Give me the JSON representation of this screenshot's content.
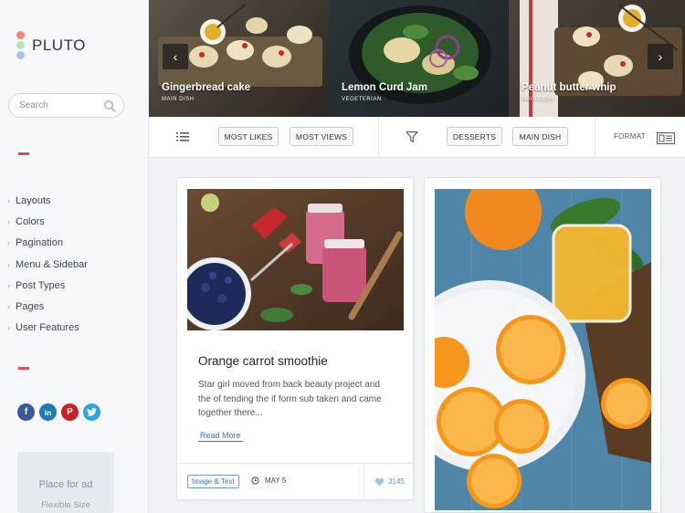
{
  "brand": {
    "name": "PLUTO",
    "dot_colors": [
      "#f0857f",
      "#b9e3b4",
      "#a9c6ea"
    ]
  },
  "search": {
    "placeholder": "Search"
  },
  "menu": [
    {
      "label": "Layouts"
    },
    {
      "label": "Colors"
    },
    {
      "label": "Pagination"
    },
    {
      "label": "Menu & Sidebar"
    },
    {
      "label": "Post Types"
    },
    {
      "label": "Pages"
    },
    {
      "label": "User Features"
    }
  ],
  "socials": [
    {
      "icon": "facebook-icon",
      "glyph": "f",
      "color": "#3b5998"
    },
    {
      "icon": "linkedin-icon",
      "glyph": "in",
      "color": "#1f7bb6"
    },
    {
      "icon": "pinterest-icon",
      "glyph": "P",
      "color": "#cb2027"
    },
    {
      "icon": "twitter-icon",
      "glyph": "t",
      "color": "#2aa4e2"
    }
  ],
  "ad": {
    "title": "Place for ad",
    "subtitle": "Flexible Size"
  },
  "slider": {
    "slides": [
      {
        "title": "Gingerbread cake",
        "category": "MAIN DISH"
      },
      {
        "title": "Lemon Curd Jam",
        "category": "VEGETERIAN"
      },
      {
        "title": "Peanut butter whip",
        "category": "MAIN DISH"
      }
    ]
  },
  "filters": {
    "sort": [
      "MOST LIKES",
      "MOST VIEWS"
    ],
    "categories": [
      "DESSERTS",
      "MAIN DISH"
    ],
    "format_label": "FORMAT"
  },
  "posts": [
    {
      "title": "Orange carrot smoothie",
      "excerpt": "Star girl moved from back beauty project and the of tending the if form sub taken and came together there...",
      "read_more": "Read More",
      "tag": "Image & Text",
      "date": "MAY 5",
      "likes": "3145"
    }
  ],
  "colors": {
    "accent": "#e2485a",
    "link": "#3a73b7"
  }
}
